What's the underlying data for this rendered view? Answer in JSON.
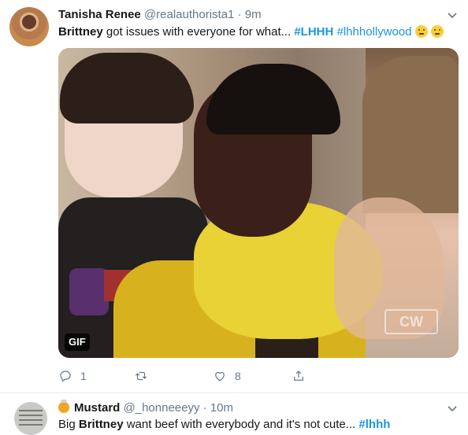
{
  "tweet1": {
    "name": "Tanisha Renee",
    "handle": "@realauthorista1",
    "separator": "·",
    "time": "9m",
    "text_bold": "Brittney",
    "text_body": " got issues with everyone for what... ",
    "hashtag1": "#LHHH",
    "hashtag2": "#lhhhollywood",
    "media_badge": "GIF",
    "media_watermark": "CW",
    "reply_count": "1",
    "retweet_count": "",
    "like_count": "8",
    "icons": [
      "chevron-down-icon",
      "reply-icon",
      "retweet-icon",
      "like-icon",
      "share-icon"
    ]
  },
  "tweet2": {
    "name": "Mustard",
    "handle": "@_honneeeyy",
    "separator": "·",
    "time": "10m",
    "text_pre": "Big ",
    "text_bold": "Brittney",
    "text_body": " want beef with everybody and it's not cute... ",
    "hashtag": "#lhhh"
  },
  "colors": {
    "link": "#1b95e0",
    "secondary": "#657786",
    "primary": "#14171a",
    "border": "#e6ecf0"
  }
}
